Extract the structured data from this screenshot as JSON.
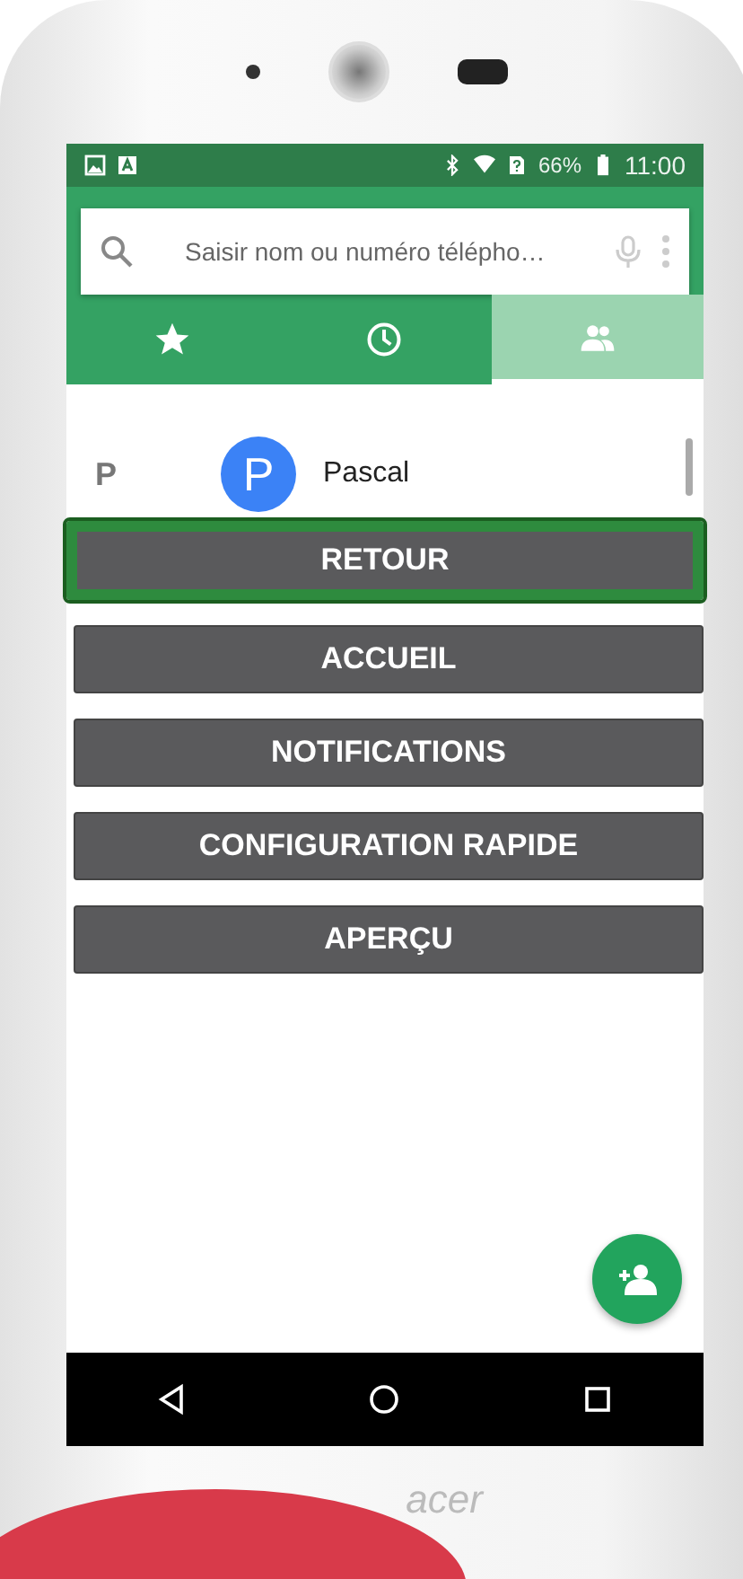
{
  "status_bar": {
    "battery": "66%",
    "time": "11:00"
  },
  "search": {
    "placeholder": "Saisir nom ou numéro télépho…"
  },
  "tabs": [
    {
      "kind": "favorites",
      "selected": false
    },
    {
      "kind": "recents",
      "selected": false
    },
    {
      "kind": "contacts",
      "selected": true
    }
  ],
  "contacts": [
    {
      "section": "P",
      "avatar_letter": "P",
      "name": "Pascal"
    }
  ],
  "overlay_menu": [
    {
      "label": "RETOUR",
      "selected": true
    },
    {
      "label": "ACCUEIL",
      "selected": false
    },
    {
      "label": "NOTIFICATIONS",
      "selected": false
    },
    {
      "label": "CONFIGURATION RAPIDE",
      "selected": false
    },
    {
      "label": "APERÇU",
      "selected": false
    }
  ],
  "phone": {
    "brand": "acer"
  }
}
